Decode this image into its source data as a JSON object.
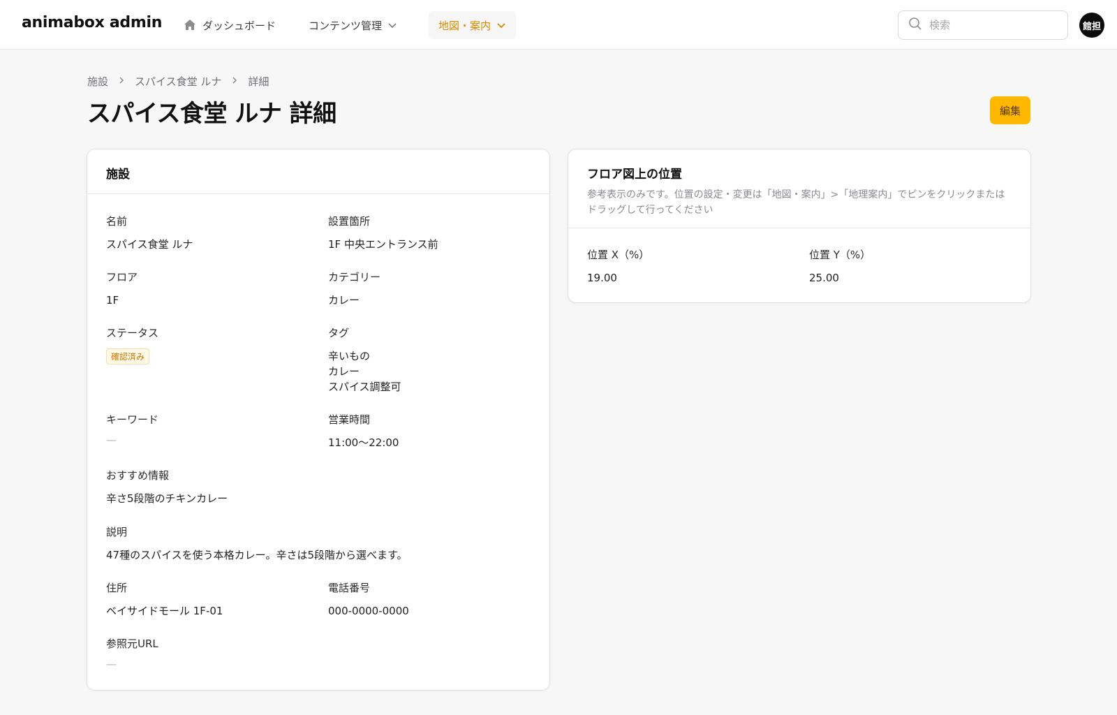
{
  "header": {
    "brand": "animabox admin",
    "nav": {
      "dashboard": "ダッシュボード",
      "content": "コンテンツ管理",
      "map": "地図・案内"
    },
    "search_placeholder": "検索",
    "avatar_text": "館担"
  },
  "breadcrumb": [
    "施設",
    "スパイス食堂 ルナ",
    "詳細"
  ],
  "page_title": "スパイス食堂 ルナ 詳細",
  "edit_label": "編集",
  "facility_card": {
    "title": "施設",
    "fields": {
      "name": {
        "label": "名前",
        "value": "スパイス食堂 ルナ"
      },
      "location": {
        "label": "設置箇所",
        "value": "1F 中央エントランス前"
      },
      "floor": {
        "label": "フロア",
        "value": "1F"
      },
      "category": {
        "label": "カテゴリー",
        "value": "カレー"
      },
      "status": {
        "label": "ステータス",
        "value": "確認済み"
      },
      "tags": {
        "label": "タグ",
        "values": [
          "辛いもの",
          "カレー",
          "スパイス調整可"
        ]
      },
      "keywords": {
        "label": "キーワード",
        "value": "—"
      },
      "hours": {
        "label": "営業時間",
        "value": "11:00〜22:00"
      },
      "recommend": {
        "label": "おすすめ情報",
        "value": "辛さ5段階のチキンカレー"
      },
      "description": {
        "label": "説明",
        "value": "47種のスパイスを使う本格カレー。辛さは5段階から選べます。"
      },
      "address": {
        "label": "住所",
        "value": "ベイサイドモール 1F-01"
      },
      "phone": {
        "label": "電話番号",
        "value": "000-0000-0000"
      },
      "source_url": {
        "label": "参照元URL",
        "value": "—"
      }
    }
  },
  "position_card": {
    "title": "フロア図上の位置",
    "subtitle": "参考表示のみです。位置の設定・変更は「地図・案内」>「地理案内」でピンをクリックまたはドラッグして行ってください",
    "x": {
      "label": "位置 X（%）",
      "value": "19.00"
    },
    "y": {
      "label": "位置 Y（%）",
      "value": "25.00"
    }
  },
  "colors": {
    "accent": "#ffb800",
    "nav_active": "#d58a00",
    "badge_text": "#c77900"
  }
}
